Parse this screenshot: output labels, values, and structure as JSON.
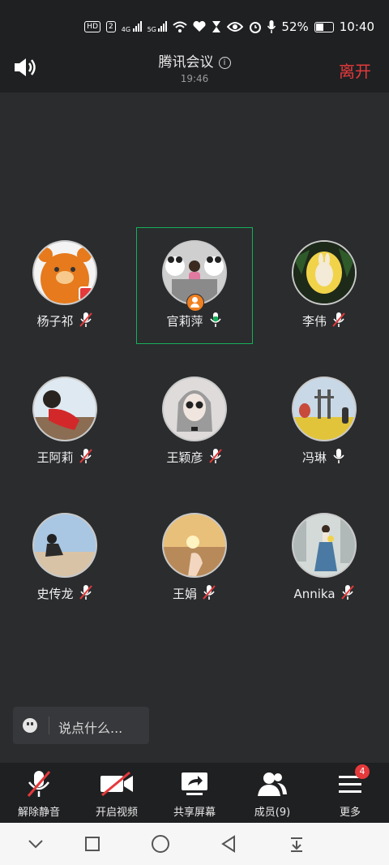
{
  "status_bar": {
    "chip_hd": "HD",
    "chip_2": "2",
    "net1": "4G",
    "net2": "5G",
    "battery": "52%",
    "time": "10:40"
  },
  "header": {
    "title": "腾讯会议",
    "info_symbol": "i",
    "duration": "19:46",
    "leave": "离开"
  },
  "participants": [
    {
      "name": "杨子祁",
      "mic": "muted"
    },
    {
      "name": "官莉萍",
      "mic": "active",
      "host": true,
      "speaking": true
    },
    {
      "name": "李伟",
      "mic": "muted"
    },
    {
      "name": "王阿莉",
      "mic": "muted"
    },
    {
      "name": "王颖彦",
      "mic": "muted"
    },
    {
      "name": "冯琳",
      "mic": "on"
    },
    {
      "name": "史传龙",
      "mic": "muted"
    },
    {
      "name": "王娟",
      "mic": "muted"
    },
    {
      "name": "Annika",
      "mic": "muted"
    }
  ],
  "chat": {
    "placeholder": "说点什么..."
  },
  "toolbar": {
    "unmute": "解除静音",
    "video": "开启视频",
    "share": "共享屏幕",
    "members": "成员(9)",
    "more": "更多",
    "more_badge": "4"
  },
  "colors": {
    "accent_red": "#e5393b",
    "active_green": "#15b05a",
    "background": "#2b2c2e"
  }
}
